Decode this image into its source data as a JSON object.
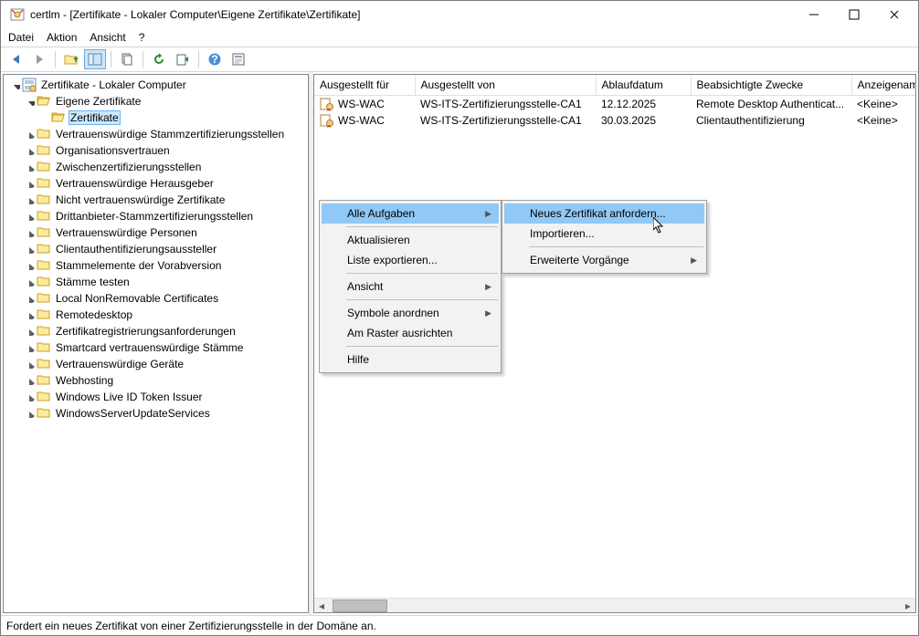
{
  "window": {
    "title": "certlm - [Zertifikate - Lokaler Computer\\Eigene Zertifikate\\Zertifikate]"
  },
  "menubar": {
    "file": "Datei",
    "action": "Aktion",
    "view": "Ansicht",
    "help": "?"
  },
  "tree": {
    "root": "Zertifikate - Lokaler Computer",
    "own_certs": "Eigene Zertifikate",
    "certs": "Zertifikate",
    "n1": "Vertrauenswürdige Stammzertifizierungsstellen",
    "n2": "Organisationsvertrauen",
    "n3": "Zwischenzertifizierungsstellen",
    "n4": "Vertrauenswürdige Herausgeber",
    "n5": "Nicht vertrauenswürdige Zertifikate",
    "n6": "Drittanbieter-Stammzertifizierungsstellen",
    "n7": "Vertrauenswürdige Personen",
    "n8": "Clientauthentifizierungsaussteller",
    "n9": "Stammelemente der Vorabversion",
    "n10": "Stämme testen",
    "n11": "Local NonRemovable Certificates",
    "n12": "Remotedesktop",
    "n13": "Zertifikatregistrierungsanforderungen",
    "n14": "Smartcard vertrauenswürdige Stämme",
    "n15": "Vertrauenswürdige Geräte",
    "n16": "Webhosting",
    "n17": "Windows Live ID Token Issuer",
    "n18": "WindowsServerUpdateServices"
  },
  "list": {
    "cols": {
      "issued_to": "Ausgestellt für",
      "issued_by": "Ausgestellt von",
      "expiry": "Ablaufdatum",
      "purpose": "Beabsichtigte Zwecke",
      "display_name": "Anzeigename"
    },
    "rows": [
      {
        "issued_to": "WS-WAC",
        "issued_by": "WS-ITS-Zertifizierungsstelle-CA1",
        "expiry": "12.12.2025",
        "purpose": "Remote Desktop Authenticat...",
        "display_name": "<Keine>"
      },
      {
        "issued_to": "WS-WAC",
        "issued_by": "WS-ITS-Zertifizierungsstelle-CA1",
        "expiry": "30.03.2025",
        "purpose": "Clientauthentifizierung",
        "display_name": "<Keine>"
      }
    ]
  },
  "ctx1": {
    "all_tasks": "Alle Aufgaben",
    "refresh": "Aktualisieren",
    "export_list": "Liste exportieren...",
    "view": "Ansicht",
    "arrange": "Symbole anordnen",
    "align": "Am Raster ausrichten",
    "help": "Hilfe"
  },
  "ctx2": {
    "request": "Neues Zertifikat anfordern...",
    "import": "Importieren...",
    "advanced": "Erweiterte Vorgänge"
  },
  "statusbar": {
    "text": "Fordert ein neues Zertifikat von einer Zertifizierungsstelle in der Domäne an."
  }
}
